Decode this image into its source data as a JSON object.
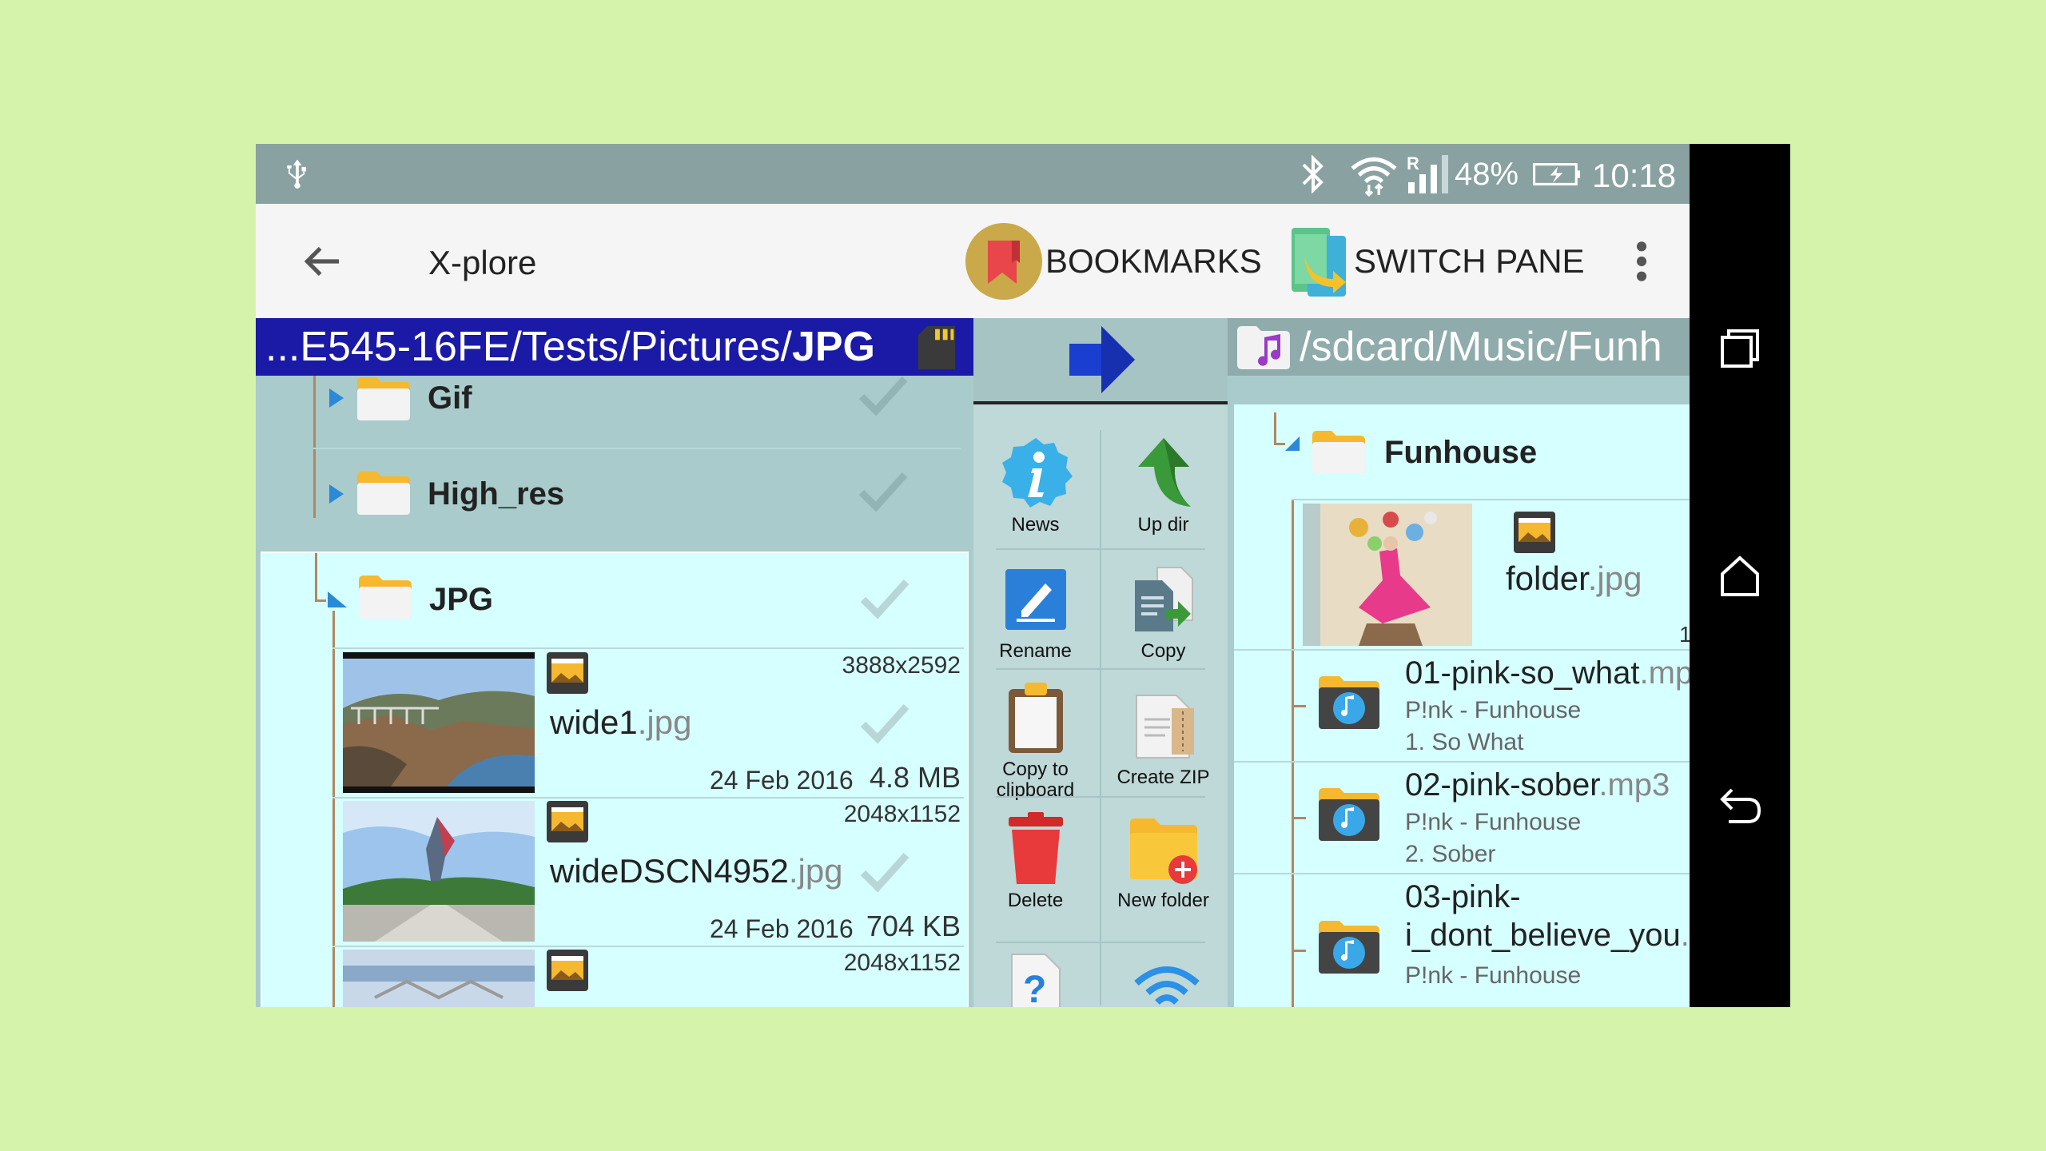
{
  "status_bar": {
    "battery_percent": "48%",
    "time": "10:18",
    "icons": [
      "usb-icon",
      "bluetooth-icon",
      "wifi-icon",
      "signal-roaming-icon",
      "battery-charging-icon"
    ]
  },
  "toolbar": {
    "title": "X-plore",
    "bookmarks_label": "BOOKMARKS",
    "switch_pane_label": "SWITCH PANE"
  },
  "left_pane": {
    "path_prefix": "...E545-16FE/Tests/Pictures/",
    "path_current": "JPG",
    "folders": [
      {
        "name": "Gif"
      },
      {
        "name": "High_res"
      },
      {
        "name": "JPG"
      }
    ],
    "files": [
      {
        "base": "wide1",
        "ext": ".jpg",
        "dimensions": "3888x2592",
        "date": "24 Feb 2016",
        "size": "4.8 MB"
      },
      {
        "base": "wideDSCN4952",
        "ext": ".jpg",
        "dimensions": "2048x1152",
        "date": "24 Feb 2016",
        "size": "704 KB"
      },
      {
        "dimensions": "2048x1152"
      }
    ]
  },
  "operations": [
    {
      "label": "News",
      "icon": "info-icon"
    },
    {
      "label": "Up dir",
      "icon": "up-arrow-icon"
    },
    {
      "label": "Rename",
      "icon": "pencil-icon"
    },
    {
      "label": "Copy",
      "icon": "copy-icon"
    },
    {
      "label": "Copy to clipboard",
      "icon": "clipboard-icon"
    },
    {
      "label": "Create ZIP",
      "icon": "zip-icon"
    },
    {
      "label": "Delete",
      "icon": "trash-icon"
    },
    {
      "label": "New folder",
      "icon": "new-folder-icon"
    }
  ],
  "right_pane": {
    "path": "/sdcard/Music/Funh",
    "folder": "Funhouse",
    "folder_image": {
      "base": "folder",
      "ext": ".jpg",
      "count": "1"
    },
    "songs": [
      {
        "base": "01-pink-so_what",
        "ext": ".mp",
        "artist": "P!nk - Funhouse",
        "track": "1.  So What"
      },
      {
        "base": "02-pink-sober",
        "ext": ".mp3",
        "artist": "P!nk - Funhouse",
        "track": "2.  Sober"
      },
      {
        "base_line1": "03-pink-",
        "base_line2": "i_dont_believe_you",
        "ext": ".",
        "artist": "P!nk - Funhouse"
      }
    ]
  }
}
